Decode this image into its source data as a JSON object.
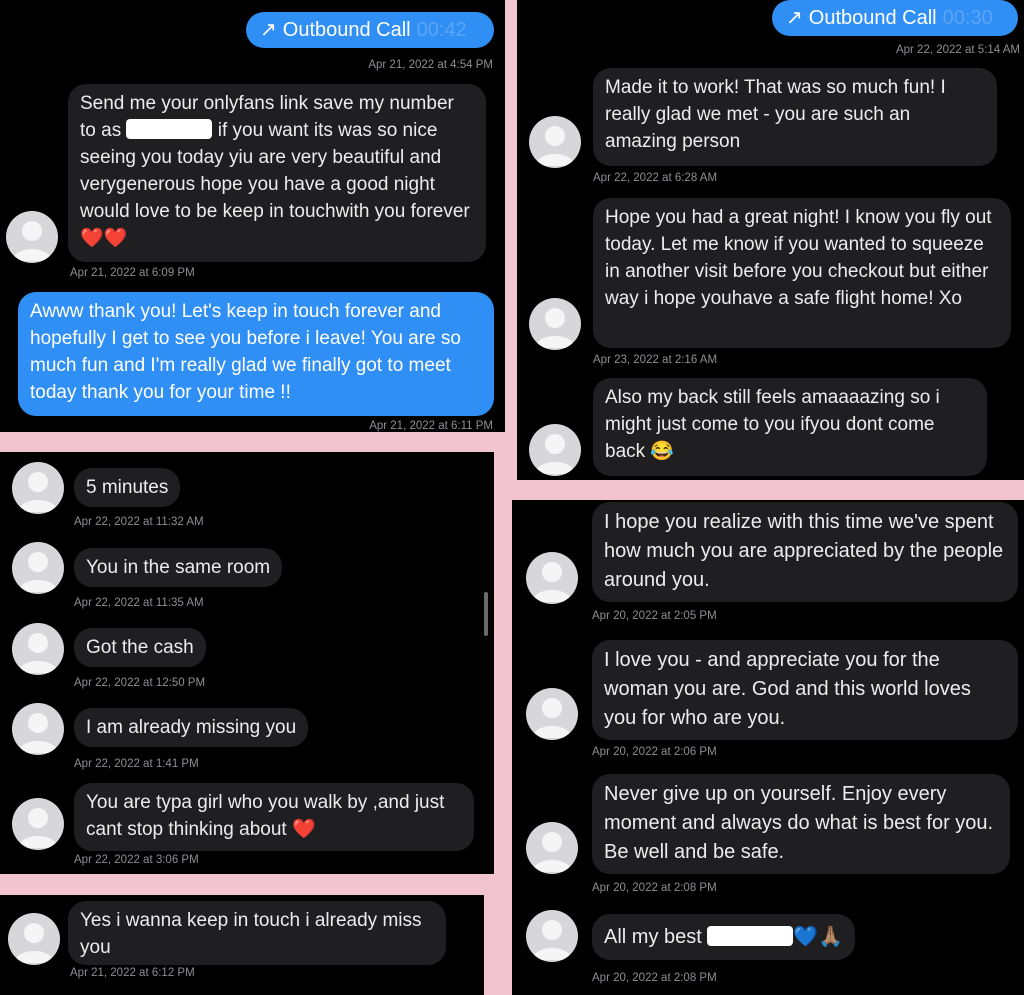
{
  "panel1": {
    "call": {
      "arrow": "↗",
      "label": "Outbound Call",
      "duration": "00:42"
    },
    "call_ts": "Apr 21, 2022 at 4:54 PM",
    "msg1_a": "Send me your onlyfans link save my number to as ",
    "msg1_b": " if you want its was so nice seeing you today yiu are very beautiful and verygenerous hope you have a good night would love to be keep in touchwith you forever ",
    "msg1_emoji": "❤️❤️",
    "ts1": "Apr 21, 2022 at 6:09 PM",
    "reply": "Awww thank you! Let's keep in touch forever and hopefully I get to see you before i leave! You are so much fun and I'm really glad we finally got to meet today thank you for your time !!",
    "reply_ts": "Apr 21, 2022 at 6:11 PM"
  },
  "panel2": {
    "call": {
      "arrow": "↗",
      "label": "Outbound Call",
      "duration": "00:30"
    },
    "call_ts": "Apr 22, 2022 at 5:14 AM",
    "m1": "Made it to work! That was so much fun! I really glad we met - you are such an amazing person",
    "t1": "Apr 22, 2022 at 6:28 AM",
    "m2": "Hope you had a great night! I know you fly out today. Let me know if you wanted to squeeze in another visit before you checkout but either way i hope youhave a safe flight home! Xo",
    "t2": "Apr 23, 2022 at 2:16 AM",
    "m3": "Also my back still feels amaaaazing so i might just come to you ifyou dont come back ",
    "m3_emoji": "😂"
  },
  "panel3": {
    "m1": "5 minutes",
    "t1": "Apr 22, 2022 at 11:32 AM",
    "m2": "You in the same room",
    "t2": "Apr 22, 2022 at 11:35 AM",
    "m3": "Got the cash",
    "t3": "Apr 22, 2022 at 12:50 PM",
    "m4": "I am already missing you",
    "t4": "Apr 22, 2022 at 1:41 PM",
    "m5": "You are typa girl who you walk by ,and just cant stop thinking about ",
    "m5_emoji": "❤️",
    "t5": "Apr 22, 2022 at 3:06 PM"
  },
  "panel4": {
    "m1": "Yes i wanna keep in touch i already miss you",
    "t1": "Apr 21, 2022 at 6:12 PM"
  },
  "panel5": {
    "m1": "I hope you realize with this time we've spent how much you are appreciated by the people around you.",
    "t1": "Apr 20, 2022 at 2:05 PM",
    "m2": "I love you - and appreciate you for the woman you are. God and this world loves you for who are you.",
    "t2": "Apr 20, 2022 at 2:06 PM",
    "m3": "Never give up on yourself. Enjoy every moment and always do what is best for you. Be well and be safe.",
    "t3": "Apr 20, 2022 at 2:08 PM",
    "m4": "All my best ",
    "m4_emoji": "💙🙏🏽",
    "t4": "Apr 20, 2022 at 2:08 PM"
  },
  "colors": {
    "frame": "#f2c4cf",
    "panel": "#000000",
    "incoming": "#1f1f21",
    "outgoing": "#2f8ff5",
    "timestamp": "#8e8e93"
  },
  "icons": {
    "avatar": "contact-avatar-icon",
    "call": "outbound-call-arrow-icon"
  }
}
